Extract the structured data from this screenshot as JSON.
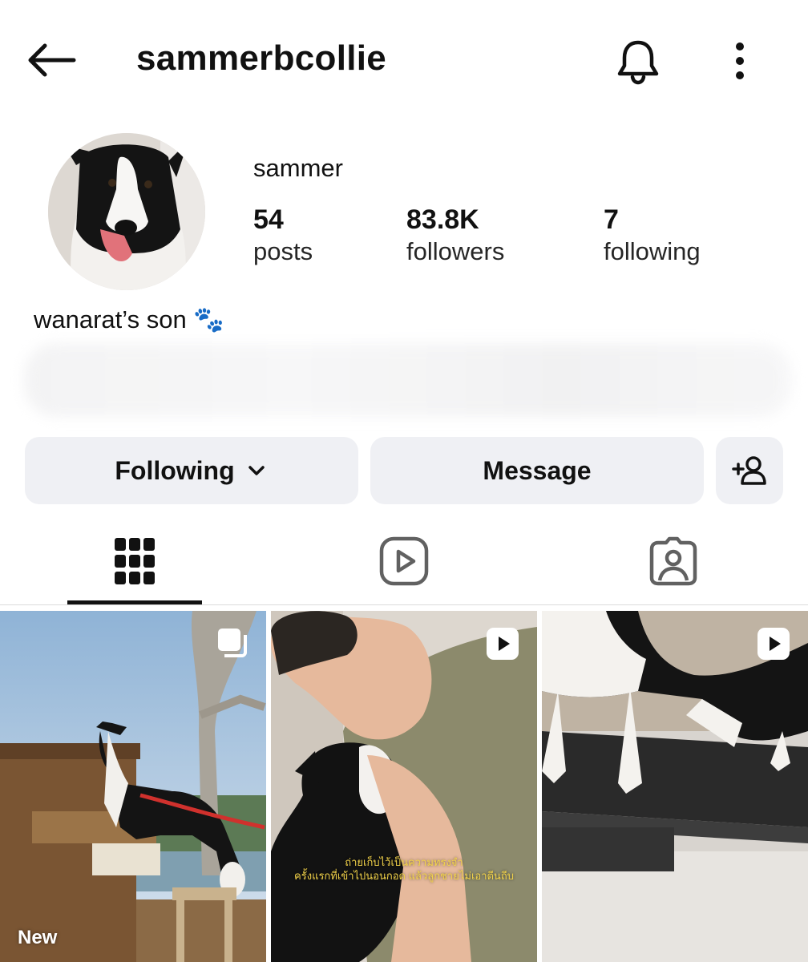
{
  "header": {
    "username": "sammerbcollie",
    "icons": {
      "back": "back-arrow-icon",
      "notifications": "bell-icon",
      "more": "more-vertical-icon"
    }
  },
  "profile": {
    "display_name": "sammer",
    "bio": "wanarat’s son 🐾",
    "stats": [
      {
        "value": "54",
        "label": "posts"
      },
      {
        "value": "83.8K",
        "label": "followers"
      },
      {
        "value": "7",
        "label": "following"
      }
    ]
  },
  "actions": {
    "following_label": "Following",
    "message_label": "Message",
    "add_friend_icon": "person-add-icon"
  },
  "tabs": [
    {
      "name": "posts",
      "icon": "grid-icon",
      "selected": true
    },
    {
      "name": "reels",
      "icon": "reels-icon",
      "selected": false
    },
    {
      "name": "tagged",
      "icon": "tagged-icon",
      "selected": false
    }
  ],
  "posts": [
    {
      "type": "carousel",
      "badge": "new",
      "new_label": "New",
      "badge_icon": "carousel-icon"
    },
    {
      "type": "reel",
      "badge_icon": "reel-icon",
      "caption_line1": "ถ่ายเก็บไว้เป็นความทรงจำ",
      "caption_line2": "ครั้งแรกที่เข้าไปนอนกอด แล้วลูกชายไม่เอาตีนถีบ"
    },
    {
      "type": "reel",
      "badge_icon": "reel-icon"
    }
  ],
  "colors": {
    "button_bg": "#eff0f4",
    "text": "#111111",
    "divider": "#dbdbdb"
  }
}
